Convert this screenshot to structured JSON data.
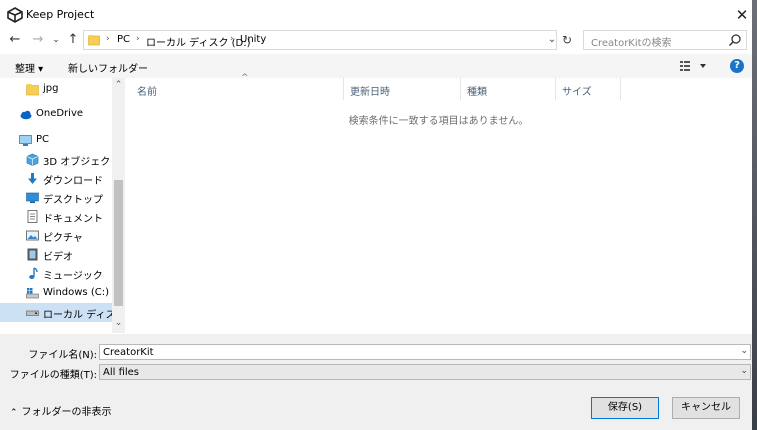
{
  "window": {
    "title": "Keep Project",
    "close_glyph": "✕"
  },
  "nav": {
    "back_glyph": "←",
    "forward_glyph": "→",
    "recent_glyph": "⌄",
    "up_glyph": "↑",
    "breadcrumbs": [
      "PC",
      "ローカル ディスク (D:)",
      "Unity"
    ],
    "separator": "›",
    "dropdown_glyph": "⌄",
    "refresh_glyph": "↻",
    "search_placeholder": "CreatorKitの検索"
  },
  "toolbar": {
    "organize_label": "整理 ▾",
    "new_folder_label": "新しいフォルダー",
    "help_label": "?"
  },
  "sidebar": {
    "items": [
      {
        "label": "jpg",
        "icon": "folder-icon"
      },
      {
        "label": "OneDrive",
        "icon": "cloud-icon"
      },
      {
        "label": "PC",
        "icon": "pc-icon"
      },
      {
        "label": "3D オブジェクト",
        "icon": "3d-objects-icon"
      },
      {
        "label": "ダウンロード",
        "icon": "download-icon"
      },
      {
        "label": "デスクトップ",
        "icon": "desktop-icon"
      },
      {
        "label": "ドキュメント",
        "icon": "document-icon"
      },
      {
        "label": "ピクチャ",
        "icon": "pictures-icon"
      },
      {
        "label": "ビデオ",
        "icon": "video-icon"
      },
      {
        "label": "ミュージック",
        "icon": "music-icon"
      },
      {
        "label": "Windows (C:)",
        "icon": "windows-drive-icon"
      },
      {
        "label": "ローカル ディスク (D",
        "icon": "local-disk-icon"
      }
    ],
    "scroll_up": "⌃",
    "scroll_down": "⌄"
  },
  "filelist": {
    "columns": [
      "名前",
      "更新日時",
      "種類",
      "サイズ"
    ],
    "sort_indicator": "^",
    "empty_message": "検索条件に一致する項目はありません。"
  },
  "footer": {
    "filename_label": "ファイル名(N):",
    "filename_value": "CreatorKit",
    "filetype_label": "ファイルの種類(T):",
    "filetype_value": "All files",
    "combo_arrow": "⌄",
    "hide_folders_chevron": "⌃",
    "hide_folders_label": "フォルダーの非表示",
    "save_label": "保存(S)",
    "cancel_label": "キャンセル"
  },
  "colors": {
    "accent": "#0078d7",
    "selected_nav": "#cde1f5",
    "folder": "#f7ce54"
  }
}
